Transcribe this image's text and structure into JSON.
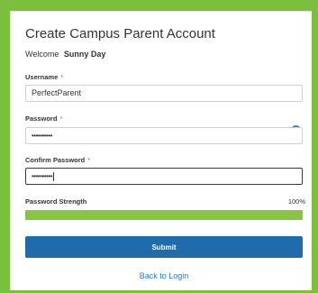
{
  "page": {
    "title": "Create Campus Parent Account",
    "welcome_prefix": "Welcome",
    "welcome_name": "Sunny Day"
  },
  "form": {
    "username": {
      "label": "Username",
      "required_mark": "*",
      "value": "PerfectParent"
    },
    "password": {
      "label": "Password",
      "required_mark": "*",
      "value": "••••••••••",
      "info_icon": "info-icon",
      "info_glyph": "i"
    },
    "confirm_password": {
      "label": "Confirm Password",
      "required_mark": "*",
      "value": "••••••••••"
    },
    "strength": {
      "label": "Password Strength",
      "percent_text": "100%",
      "percent": 100
    },
    "submit_label": "Submit",
    "back_link": "Back to Login"
  },
  "colors": {
    "background": "#7cbf3f",
    "strength_fill": "#8bc34a",
    "submit": "#1f6bab",
    "link": "#2a79be",
    "required": "#d9534f"
  }
}
